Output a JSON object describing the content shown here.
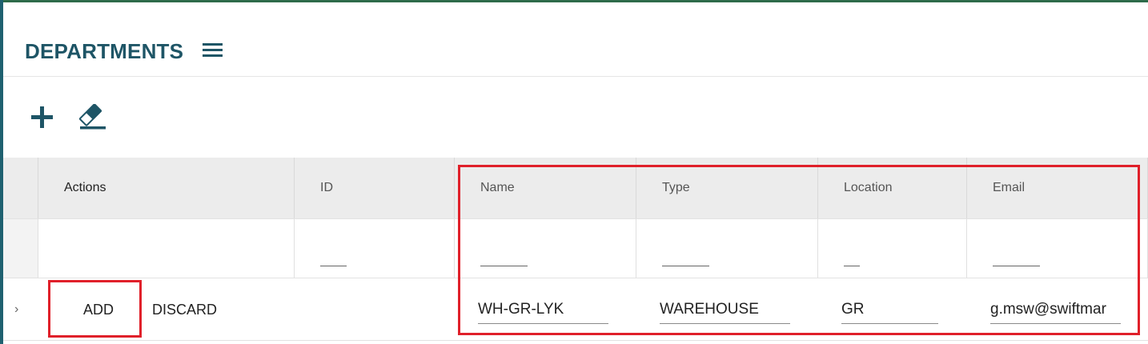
{
  "page": {
    "title": "DEPARTMENTS",
    "menu_icon": "hamburger-menu-icon"
  },
  "toolbar": {
    "add_icon": "plus-icon",
    "clear_icon": "eraser-icon"
  },
  "grid": {
    "columns": [
      "",
      "Actions",
      "ID",
      "Name",
      "Type",
      "Location",
      "Email"
    ],
    "new_row": {
      "expand_icon": "chevron-right-icon",
      "chevron": "›",
      "add_label": "ADD",
      "discard_label": "DISCARD",
      "id": "",
      "name": "WH-GR-LYK",
      "type": "WAREHOUSE",
      "location": "GR",
      "email": "g.msw@swiftmar"
    }
  },
  "colors": {
    "brand": "#1e5566",
    "highlight": "#e0202a",
    "header_bg": "#ececec"
  }
}
